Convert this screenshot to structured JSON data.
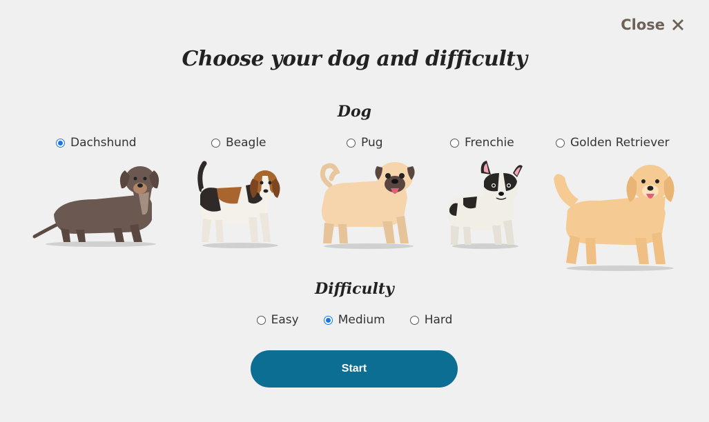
{
  "close": {
    "label": "Close",
    "icon": "close-x-icon"
  },
  "title": "Choose your dog and difficulty",
  "dog_section": {
    "heading": "Dog",
    "options": [
      {
        "label": "Dachshund",
        "selected": true
      },
      {
        "label": "Beagle",
        "selected": false
      },
      {
        "label": "Pug",
        "selected": false
      },
      {
        "label": "Frenchie",
        "selected": false
      },
      {
        "label": "Golden Retriever",
        "selected": false
      }
    ]
  },
  "difficulty_section": {
    "heading": "Difficulty",
    "options": [
      {
        "label": "Easy",
        "selected": false
      },
      {
        "label": "Medium",
        "selected": true
      },
      {
        "label": "Hard",
        "selected": false
      }
    ]
  },
  "start_button": {
    "label": "Start"
  },
  "colors": {
    "background": "#f0f0f0",
    "accent": "#0d6e94",
    "radio_selected": "#1a73e8",
    "close_text": "#6b6158"
  }
}
